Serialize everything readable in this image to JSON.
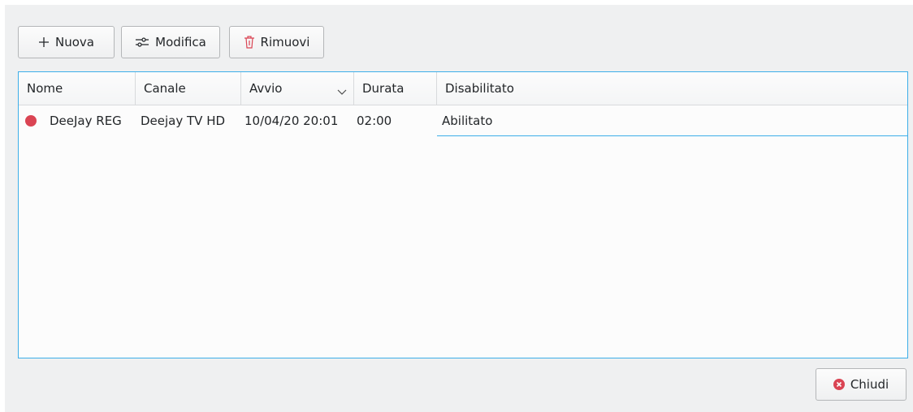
{
  "toolbar": {
    "new_label": "Nuova",
    "edit_label": "Modifica",
    "remove_label": "Rimuovi"
  },
  "table": {
    "columns": [
      "Nome",
      "Canale",
      "Avvio",
      "Durata",
      "Disabilitato"
    ],
    "sort_column": "Avvio",
    "sort_order": "descending",
    "rows": [
      {
        "status": "recording",
        "name": "DeeJay REG",
        "channel": "Deejay TV HD",
        "start": "10/04/20 20:01",
        "duration": "02:00",
        "disabled": "Abilitato"
      }
    ]
  },
  "footer": {
    "close_label": "Chiudi"
  },
  "icons": {
    "new": "plus-icon",
    "edit": "sliders-icon",
    "remove": "trash-icon",
    "close": "close-circle-icon",
    "sort": "chevron-down-icon",
    "status": "record-dot-icon"
  },
  "colors": {
    "accent": "#3daee9",
    "record": "#da4453",
    "danger": "#da4453",
    "window_bg": "#eff0f1",
    "view_bg": "#fcfcfc"
  }
}
